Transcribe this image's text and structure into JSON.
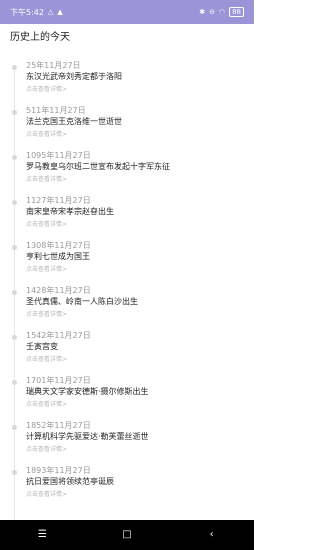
{
  "status_bar": {
    "time": "下午5:42",
    "battery": "88"
  },
  "page": {
    "title": "历史上的今天"
  },
  "events": [
    {
      "date": "25年11月27日",
      "title": "东汉光武帝刘秀定都于洛阳",
      "detail": "点击查看详情>"
    },
    {
      "date": "511年11月27日",
      "title": "法兰克国王克洛维一世逝世",
      "detail": "点击查看详情>"
    },
    {
      "date": "1095年11月27日",
      "title": "罗马教皇乌尔班二世宣布发起十字军东征",
      "detail": "点击查看详情>"
    },
    {
      "date": "1127年11月27日",
      "title": "南宋皇帝宋孝宗赵昚出生",
      "detail": "点击查看详情>"
    },
    {
      "date": "1308年11月27日",
      "title": "亨利七世成为国王",
      "detail": "点击查看详情>"
    },
    {
      "date": "1428年11月27日",
      "title": "圣代真儒、岭南一人陈白沙出生",
      "detail": "点击查看详情>"
    },
    {
      "date": "1542年11月27日",
      "title": "壬寅宫变",
      "detail": "点击查看详情>"
    },
    {
      "date": "1701年11月27日",
      "title": "瑞典天文学家安德斯·摄尔修斯出生",
      "detail": "点击查看详情>"
    },
    {
      "date": "1852年11月27日",
      "title": "计算机科学先驱爱达·勒芙蕾丝逝世",
      "detail": "点击查看详情>"
    },
    {
      "date": "1893年11月27日",
      "title": "抗日爱国将领续范亭诞辰",
      "detail": "点击查看详情>"
    }
  ],
  "icons": {
    "nav_menu": "menu-icon",
    "nav_home": "home-icon",
    "nav_back": "back-icon"
  }
}
